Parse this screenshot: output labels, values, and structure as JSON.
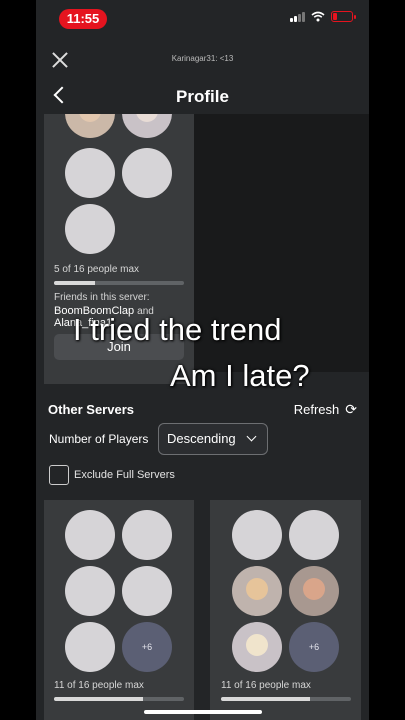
{
  "status": {
    "time": "11:55"
  },
  "header": {
    "account": "Karinagar31: <13",
    "title": "Profile"
  },
  "current_server": {
    "capacity_text": "5 of 16 people max",
    "capacity_fraction": 0.3125,
    "friends_label": "Friends in this server:",
    "friend1": "BoomBoomClap",
    "and": "and",
    "friend2": "Alana_fina1",
    "join_label": "Join"
  },
  "overlay": {
    "line1": "I tried the trend",
    "line2": "Am I late?"
  },
  "other_servers": {
    "title": "Other Servers",
    "refresh_label": "Refresh",
    "filter_label": "Number of Players",
    "sort_value": "Descending",
    "exclude_label": "Exclude Full Servers"
  },
  "servers": [
    {
      "more": "+6",
      "capacity_text": "11 of 16 people max",
      "capacity_fraction": 0.6875
    },
    {
      "more": "+6",
      "capacity_text": "11 of 16 people max",
      "capacity_fraction": 0.6875
    }
  ],
  "colors": {
    "accent_red": "#e5141f",
    "card": "#393b3d",
    "background": "#232527"
  }
}
